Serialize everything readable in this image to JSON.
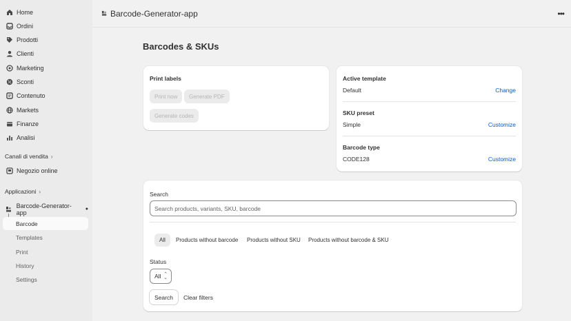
{
  "sidebar": {
    "nav": [
      {
        "label": "Home",
        "icon": "home-icon"
      },
      {
        "label": "Ordini",
        "icon": "inbox-icon"
      },
      {
        "label": "Prodotti",
        "icon": "tag-icon"
      },
      {
        "label": "Clienti",
        "icon": "person-icon"
      },
      {
        "label": "Marketing",
        "icon": "target-icon"
      },
      {
        "label": "Sconti",
        "icon": "discount-icon"
      },
      {
        "label": "Contenuto",
        "icon": "content-icon"
      },
      {
        "label": "Markets",
        "icon": "globe-icon"
      },
      {
        "label": "Finanze",
        "icon": "bank-icon"
      },
      {
        "label": "Analisi",
        "icon": "chart-icon"
      }
    ],
    "sales_channels_label": "Canali di vendita",
    "online_store_label": "Negozio online",
    "apps_label": "Applicazioni",
    "app_name": "Barcode-Generator-app",
    "app_subitems": [
      "Barcode",
      "Templates",
      "Print",
      "History",
      "Settings"
    ]
  },
  "topbar": {
    "title": "Barcode-Generator-app",
    "more": "•••"
  },
  "page": {
    "title": "Barcodes & SKUs"
  },
  "print_labels": {
    "title": "Print labels",
    "print_now": "Print now",
    "generate_pdf": "Generate PDF",
    "generate_codes": "Generate codes"
  },
  "template_card": {
    "active_template_title": "Active template",
    "active_template_value": "Default",
    "active_template_action": "Change",
    "sku_preset_title": "SKU preset",
    "sku_preset_value": "Simple",
    "sku_preset_action": "Customize",
    "barcode_type_title": "Barcode type",
    "barcode_type_value": "CODE128",
    "barcode_type_action": "Customize"
  },
  "search": {
    "label": "Search",
    "placeholder": "Search products, variants, SKU, barcode",
    "tabs": [
      "All",
      "Products without barcode",
      "Products without SKU",
      "Products without barcode & SKU"
    ],
    "status_label": "Status",
    "status_value": "All",
    "search_button": "Search",
    "clear_button": "Clear filters"
  },
  "colors": {
    "link": "#005bd3",
    "sidebar_bg": "#ebebeb",
    "page_bg": "#f1f1f1"
  }
}
